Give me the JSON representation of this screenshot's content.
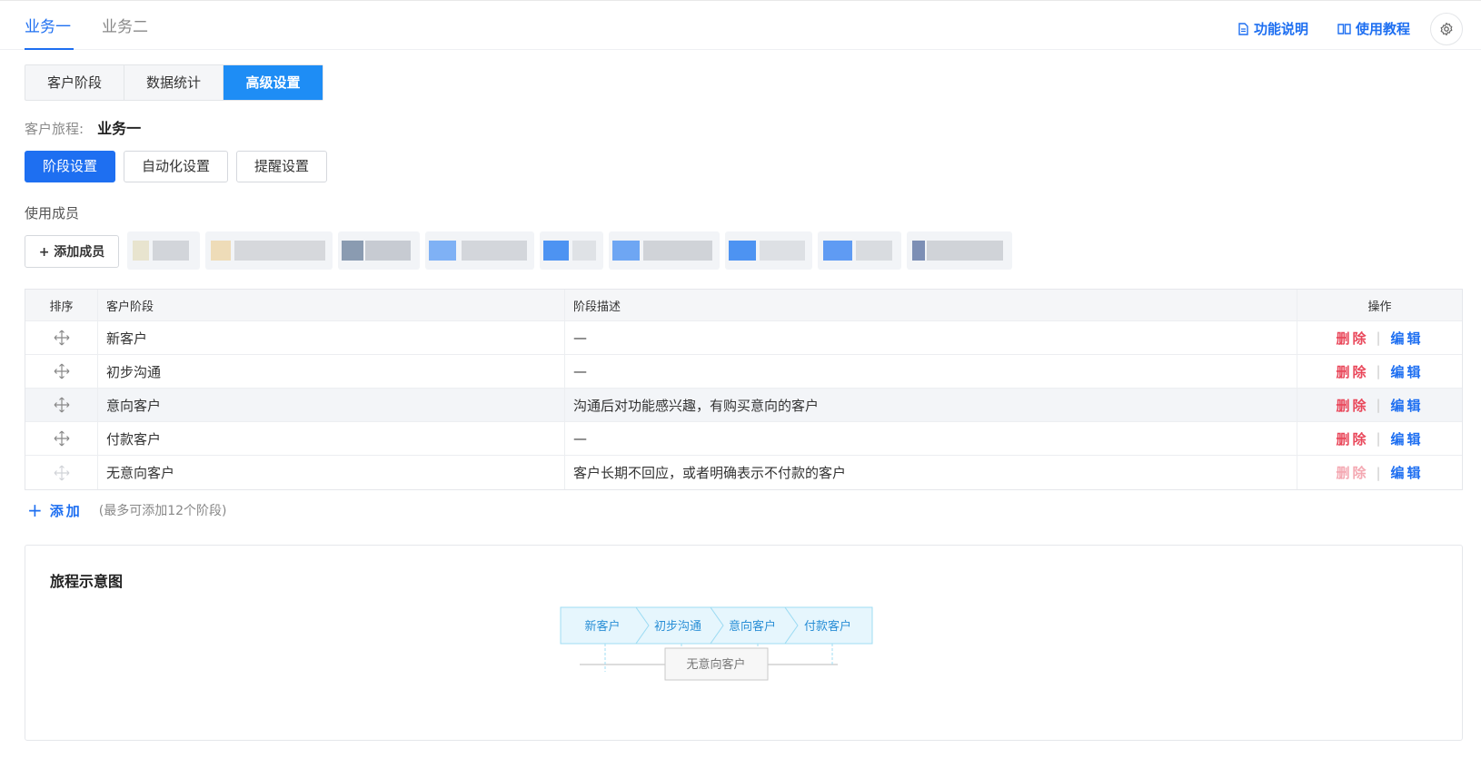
{
  "top_tabs": [
    "业务一",
    "业务二"
  ],
  "top_links": {
    "help": "功能说明",
    "tutorial": "使用教程"
  },
  "segments": [
    "客户阶段",
    "数据统计",
    "高级设置"
  ],
  "journey": {
    "label": "客户旅程:",
    "value": "业务一"
  },
  "sub_tabs": [
    "阶段设置",
    "自动化设置",
    "提醒设置"
  ],
  "members": {
    "label": "使用成员",
    "add_label": "+ 添加成员"
  },
  "table": {
    "headers": [
      "排序",
      "客户阶段",
      "阶段描述",
      "操作"
    ],
    "rows": [
      {
        "stage": "新客户",
        "desc": "—"
      },
      {
        "stage": "初步沟通",
        "desc": "—"
      },
      {
        "stage": "意向客户",
        "desc": "沟通后对功能感兴趣，有购买意向的客户"
      },
      {
        "stage": "付款客户",
        "desc": "—"
      },
      {
        "stage": "无意向客户",
        "desc": "客户长期不回应，或者明确表示不付款的客户"
      }
    ],
    "delete_label": "删除",
    "edit_label": "编辑",
    "sep": "|"
  },
  "add": {
    "label": "添加",
    "hint": "(最多可添加12个阶段)"
  },
  "diagram": {
    "title": "旅程示意图",
    "stages": [
      "新客户",
      "初步沟通",
      "意向客户",
      "付款客户"
    ],
    "exit_stage": "无意向客户"
  },
  "colors": {
    "accent": "#1e6ff1",
    "danger": "#e9475a",
    "flow_fill": "#e6f6fd",
    "flow_stroke": "#9fdcf3"
  }
}
